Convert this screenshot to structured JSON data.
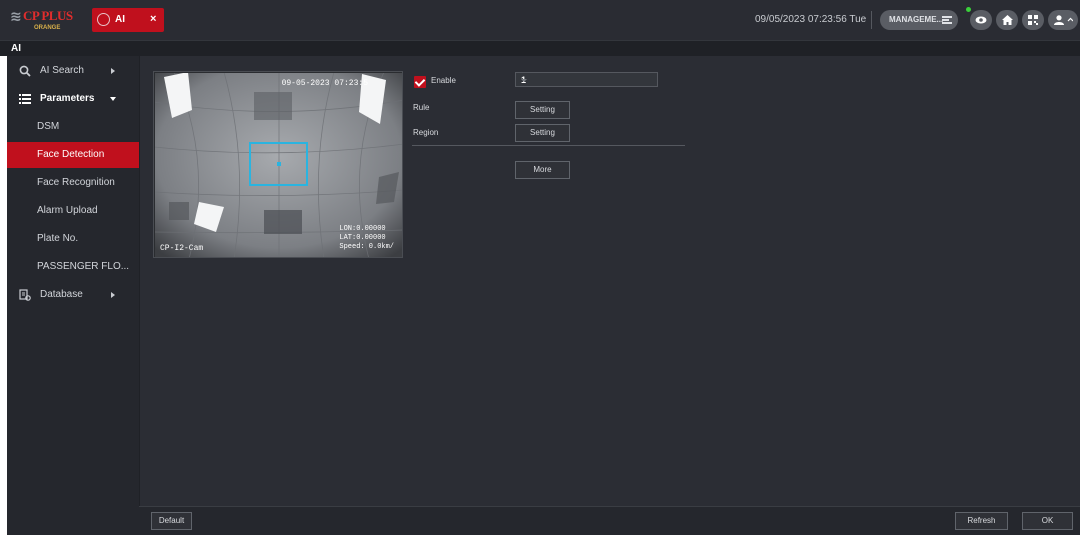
{
  "topbar": {
    "logo_mark": "≋",
    "logo_text": "CP PLUS",
    "logo_sub": "ORANGE",
    "tab": {
      "label": "AI",
      "icon": "ai-icon",
      "close": "×"
    },
    "datetime": "09/05/2023 07:23:56 Tue",
    "manage_label": "MANAGEME...",
    "icons": [
      "menu-icon",
      "eye-icon",
      "home-icon",
      "qr-code-icon",
      "user-icon"
    ]
  },
  "breadcrumb": "AI",
  "sidebar": {
    "items": [
      {
        "label": "AI Search",
        "icon": "ai-search-icon"
      },
      {
        "label": "Parameters",
        "icon": "list-icon"
      },
      {
        "label": "DSM"
      },
      {
        "label": "Face Detection",
        "active": true
      },
      {
        "label": "Face Recognition"
      },
      {
        "label": "Alarm Upload"
      },
      {
        "label": "Plate No."
      },
      {
        "label": "PASSENGER FLO..."
      },
      {
        "label": "Database",
        "icon": "database-icon"
      }
    ]
  },
  "preview": {
    "timestamp": "09-05-2023 07:23:5",
    "lon": "LON:0.00000",
    "lat": "LAT:0.00000",
    "speed": "Speed: 0.0km/",
    "cam_name": "CP-I2-Cam"
  },
  "form": {
    "enable_label": "Enable",
    "enable_checked": true,
    "channel_value": "1",
    "rule_label": "Rule",
    "region_label": "Region",
    "setting_label": "Setting",
    "more_label": "More"
  },
  "footer": {
    "default_label": "Default",
    "refresh_label": "Refresh",
    "ok_label": "OK"
  },
  "colors": {
    "accent": "#c0101d",
    "detect_box": "#2ab4e0",
    "background": "#2b2d34"
  }
}
